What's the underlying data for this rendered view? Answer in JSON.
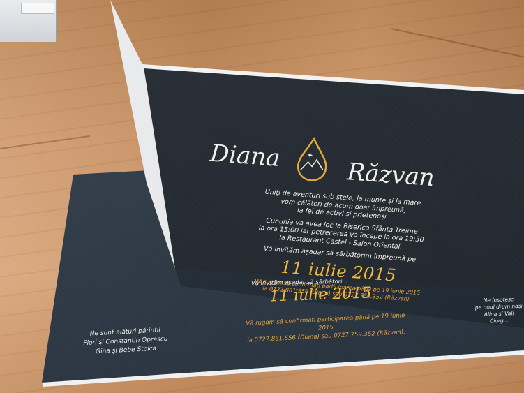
{
  "front": {
    "name_left": "Diana",
    "name_right": "Răzvan",
    "lines_1": [
      "Uniți de aventuri sub stele, la munte și la mare,",
      "vom călători de acum doar împreună,",
      "la fel de activi și prietenoși."
    ],
    "lines_2": [
      "Cununia va avea loc la Biserica Sfânta Treime",
      "la ora 15:00 iar petrecerea va începe la ora 19:30",
      "la Restaurant Castel - Salon Oriental."
    ],
    "invite_line": "Vă invităm așadar să sărbătorim împreună pe",
    "date": "11 iulie 2015",
    "rsvp_1": "Vă rugăm să confirmați participarea până pe 19 iunie 2015",
    "rsvp_2": "la 0727.861.556 (Diana) sau 0727.759.352 (Răzvan)."
  },
  "lower": {
    "invite_line": "Vă invităm așadar să sărbători...",
    "date": "11 iulie 2015",
    "rsvp_1": "Vă rugăm să confirmați participarea până pe 19 iunie 2015",
    "rsvp_2": "la 0727.861.556 (Diana) sau 0727.759.352 (Răzvan).",
    "parents_left": [
      "Ne sunt alături părinții",
      "Flori și Constantin Oprescu",
      "Gina și Bebe Stoica"
    ],
    "parents_right": [
      "Ne însoțesc",
      "pe noul drum nași",
      "Alina și Vali Ciorg..."
    ]
  },
  "colors": {
    "gold": "#f2b93b",
    "card": "#262c33",
    "panel": "#33404c"
  }
}
